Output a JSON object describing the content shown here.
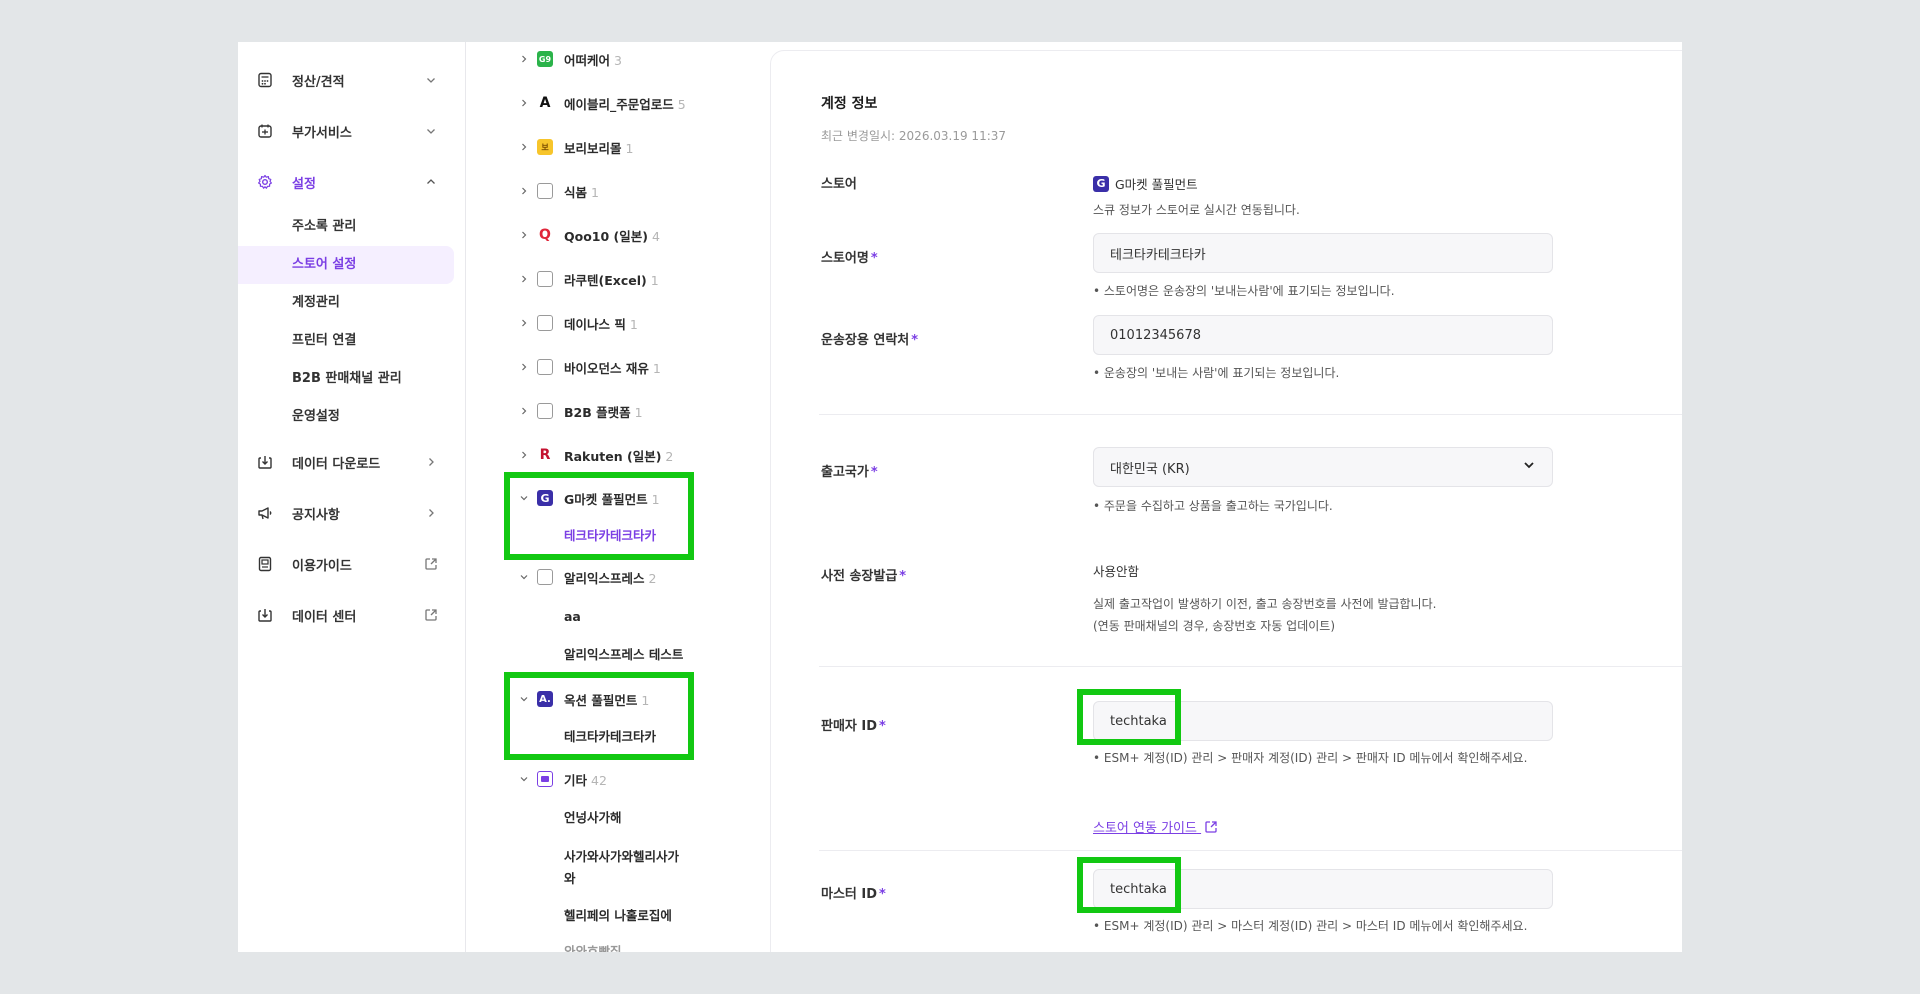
{
  "nav": {
    "items": [
      {
        "label": "정산/견적",
        "icon": "calculator-icon",
        "caret": "chevron-down-icon"
      },
      {
        "label": "부가서비스",
        "icon": "addon-icon",
        "caret": "chevron-down-icon"
      },
      {
        "label": "설정",
        "icon": "gear-icon",
        "caret": "chevron-up-icon",
        "active": true
      },
      {
        "label": "데이터 다운로드",
        "icon": "download-icon",
        "caret": "chevron-right-icon"
      },
      {
        "label": "공지사항",
        "icon": "megaphone-icon",
        "caret": "chevron-right-icon"
      },
      {
        "label": "이용가이드",
        "icon": "guide-icon",
        "caret": "external-link-icon"
      },
      {
        "label": "데이터 센터",
        "icon": "data-center-icon",
        "caret": "external-link-icon"
      }
    ],
    "settings_sub": [
      {
        "label": "주소록 관리"
      },
      {
        "label": "스토어 설정",
        "active": true
      },
      {
        "label": "계정관리"
      },
      {
        "label": "프린터 연결"
      },
      {
        "label": "B2B 판매채널 관리"
      },
      {
        "label": "운영설정"
      }
    ]
  },
  "tree": {
    "stores": [
      {
        "name": "어떠케어",
        "count": "3"
      },
      {
        "name": "에이블리_주문업로드",
        "count": "5"
      },
      {
        "name": "보리보리몰",
        "count": "1"
      },
      {
        "name": "식봄",
        "count": "1"
      },
      {
        "name": "Qoo10 (일본)",
        "count": "4"
      },
      {
        "name": "라쿠텐(Excel)",
        "count": "1"
      },
      {
        "name": "데이나스 픽",
        "count": "1"
      },
      {
        "name": "바이오던스 재유",
        "count": "1"
      },
      {
        "name": "B2B 플랫폼",
        "count": "1"
      },
      {
        "name": "Rakuten (일본)",
        "count": "2"
      },
      {
        "name": "G마켓 풀필먼트",
        "count": "1"
      },
      {
        "name": "알리익스프레스",
        "count": "2"
      },
      {
        "name": "옥션 풀필먼트",
        "count": "1"
      },
      {
        "name": "기타",
        "count": "42"
      }
    ],
    "children": {
      "gmarket": [
        "테크타카테크타카"
      ],
      "aliexpress": [
        "aa",
        "알리익스프레스 테스트"
      ],
      "auction": [
        "테크타카테크타카"
      ],
      "etc": [
        "언넝사가해",
        "사가와사가와헬리사가",
        "와",
        "헬리페의 나홀로집에",
        "와와호빵집"
      ]
    }
  },
  "panel": {
    "title": "계정 정보",
    "updated": "최근 변경일시: 2026.03.19 11:37",
    "store": {
      "label": "스토어",
      "value": "G마켓 풀필먼트",
      "help": "스큐 정보가 스토어로 실시간 연동됩니다."
    },
    "store_name": {
      "label": "스토어명",
      "value": "테크타카테크타카",
      "help": "•  스토어명은 운송장의 '보내는사람'에 표기되는 정보입니다."
    },
    "contact": {
      "label": "운송장용 연락처",
      "value": "01012345678",
      "help": "•  운송장의 '보내는 사람'에 표기되는 정보입니다."
    },
    "country": {
      "label": "출고국가",
      "value": "대한민국 (KR)",
      "help": "•  주문을 수집하고 상품을 출고하는 국가입니다."
    },
    "pre_issue": {
      "label": "사전 송장발급",
      "value": "사용안함",
      "help1": "실제 출고작업이 발생하기 이전, 출고 송장번호를 사전에 발급합니다.",
      "help2": "(연동 판매채널의 경우, 송장번호 자동 업데이트)"
    },
    "seller_id": {
      "label": "판매자 ID",
      "value": "techtaka",
      "help": "•  ESM+ 계정(ID) 관리 > 판매자 계정(ID) 관리 > 판매자 ID 메뉴에서 확인해주세요."
    },
    "guide_link": "스토어 연동 가이드",
    "master_id": {
      "label": "마스터 ID",
      "value": "techtaka",
      "help": "•  ESM+ 계정(ID) 관리 > 마스터 계정(ID) 관리 > 마스터 ID 메뉴에서 확인해주세요."
    },
    "required_mark": "*"
  },
  "colors": {
    "accent": "#7b3fe4",
    "highlight": "#12c812",
    "background": "#e3e6e8"
  }
}
